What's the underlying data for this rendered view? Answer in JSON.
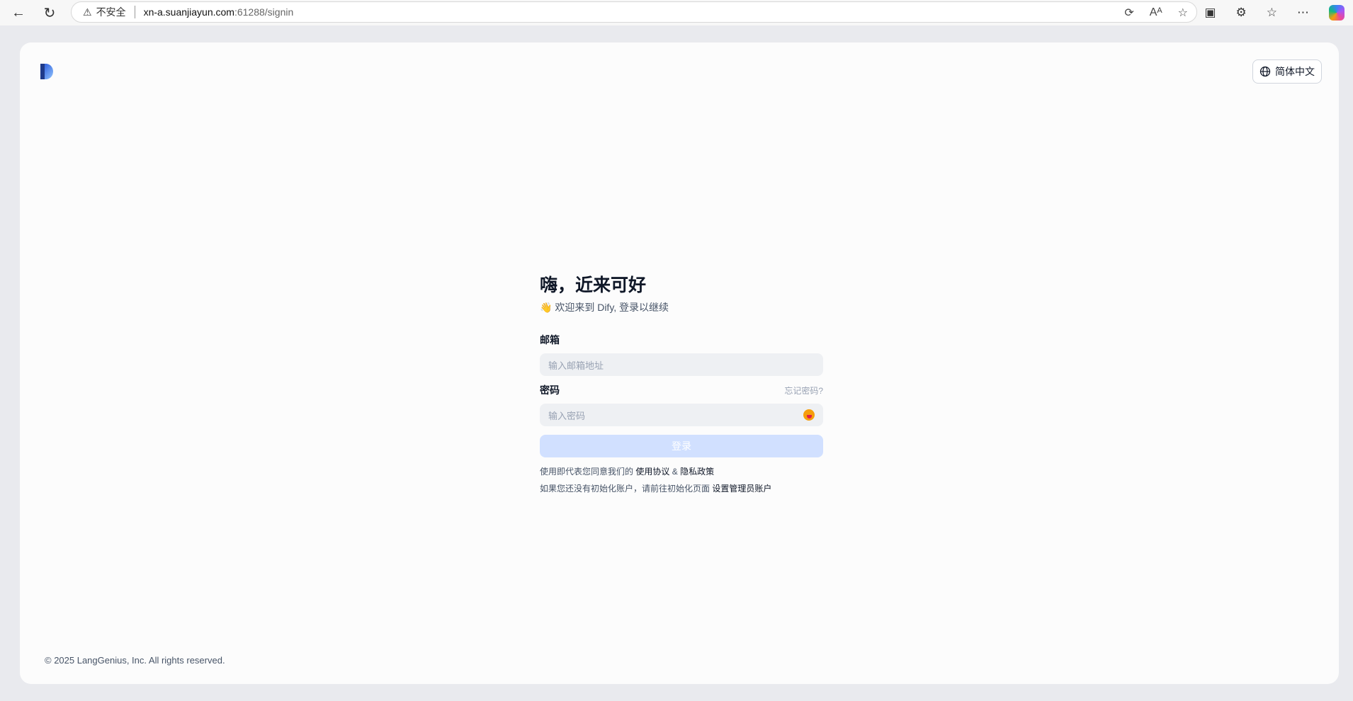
{
  "browser": {
    "insecure_label": "不安全",
    "url_host": "xn-a.suanjiayun.com",
    "url_path": ":61288/signin"
  },
  "header": {
    "language_button": "简体中文"
  },
  "signin": {
    "title": "嗨，近来可好",
    "subtitle": "👋 欢迎来到 Dify, 登录以继续",
    "email_label": "邮箱",
    "email_placeholder": "输入邮箱地址",
    "password_label": "密码",
    "forgot_password": "忘记密码?",
    "password_placeholder": "输入密码",
    "login_button": "登录",
    "terms_prefix": "使用即代表您同意我们的",
    "terms_link": "使用协议",
    "terms_and": "&",
    "privacy_link": "隐私政策",
    "init_prefix": "如果您还没有初始化账户，请前往初始化页面",
    "init_link": "设置管理员账户"
  },
  "footer": {
    "copyright": "© 2025 LangGenius, Inc. All rights reserved."
  }
}
